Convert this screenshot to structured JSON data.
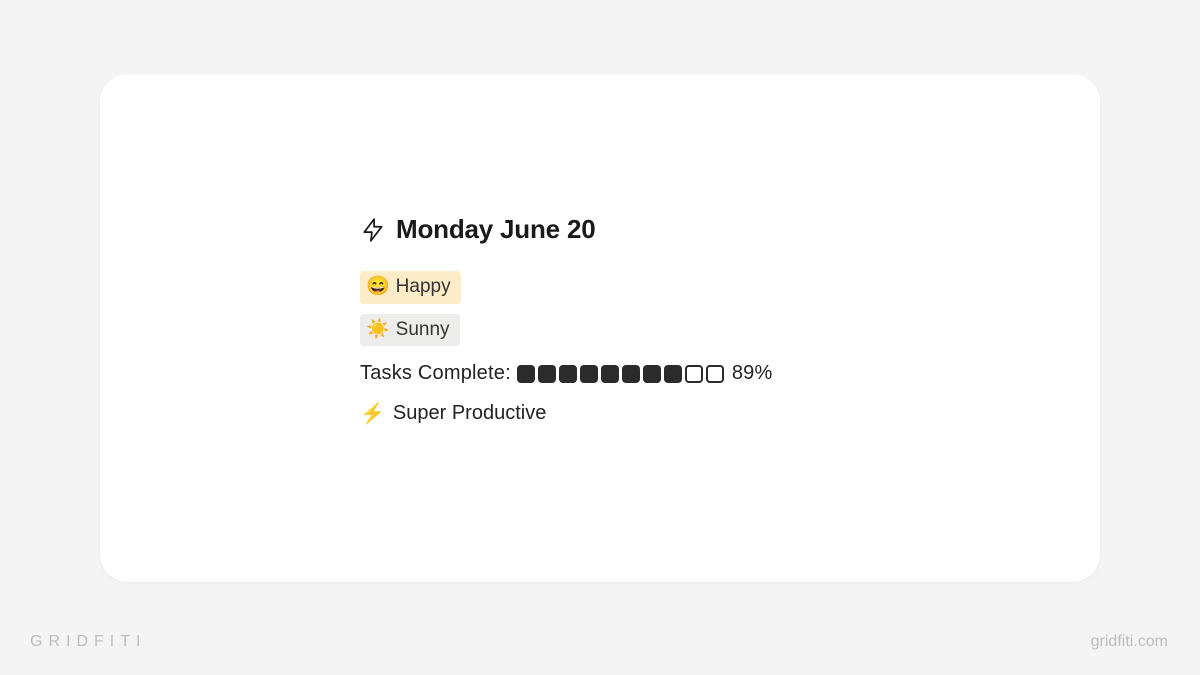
{
  "entry": {
    "title": "Monday June 20",
    "mood": {
      "emoji": "😄",
      "label": "Happy"
    },
    "weather": {
      "emoji": "☀️",
      "label": "Sunny"
    },
    "tasks": {
      "label": "Tasks Complete:",
      "filled": 8,
      "total": 10,
      "percent": "89%"
    },
    "productivity": {
      "emoji": "⚡",
      "label": "Super Productive"
    }
  },
  "watermark": {
    "left": "GRIDFITI",
    "right": "gridfiti.com"
  }
}
